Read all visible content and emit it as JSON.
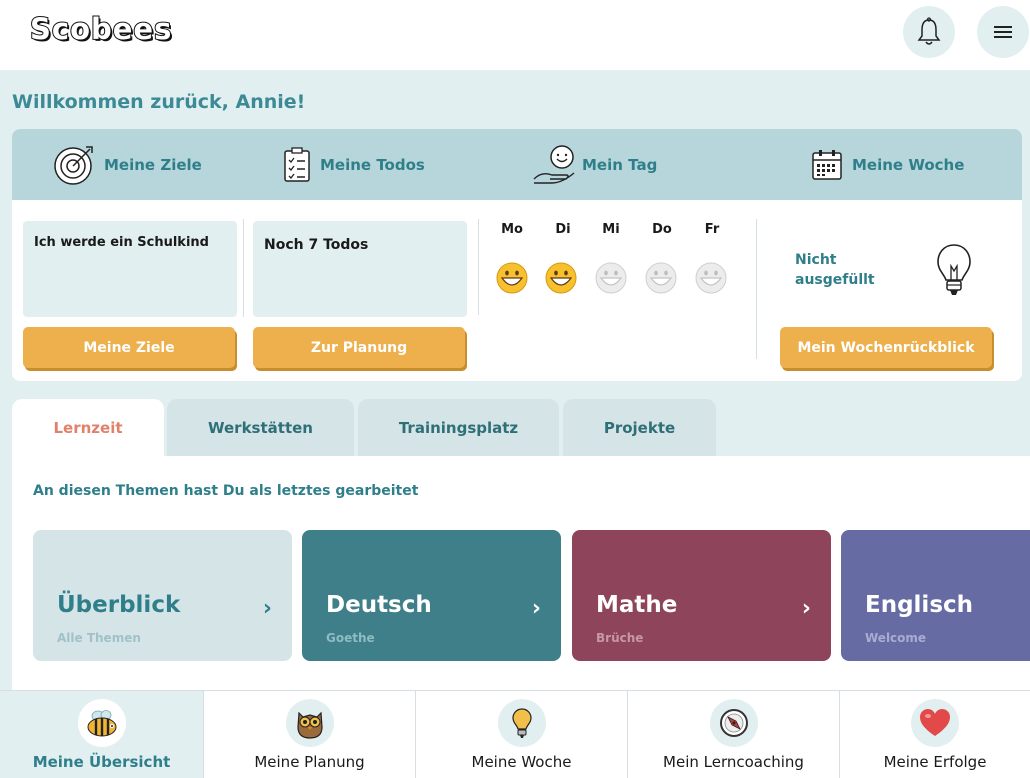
{
  "header": {
    "logo_text": "Scobees"
  },
  "welcome": "Willkommen zurück, Annie!",
  "overview_nav": [
    {
      "label": "Meine Ziele",
      "icon": "target-icon"
    },
    {
      "label": "Meine Todos",
      "icon": "checklist-icon"
    },
    {
      "label": "Mein Tag",
      "icon": "smiley-hand-icon"
    },
    {
      "label": "Meine Woche",
      "icon": "calendar-icon"
    }
  ],
  "goals": {
    "text": "Ich werde ein Schulkind",
    "button": "Meine Ziele"
  },
  "todos": {
    "text": "Noch 7 Todos",
    "button": "Zur Planung"
  },
  "days": [
    {
      "label": "Mo",
      "filled": true
    },
    {
      "label": "Di",
      "filled": true
    },
    {
      "label": "Mi",
      "filled": false
    },
    {
      "label": "Do",
      "filled": false
    },
    {
      "label": "Fr",
      "filled": false
    }
  ],
  "week": {
    "status": "Nicht ausgefüllt",
    "button": "Mein Wochenrückblick"
  },
  "tabs": [
    "Lernzeit",
    "Werkstätten",
    "Trainingsplatz",
    "Projekte"
  ],
  "active_tab": "Lernzeit",
  "recent_heading": "An diesen Themen hast Du als letztes gearbeitet",
  "cards": [
    {
      "title": "Überblick",
      "subtitle": "Alle Themen",
      "color": "#d5e4e6"
    },
    {
      "title": "Deutsch",
      "subtitle": "Goethe",
      "color": "#3f7f89"
    },
    {
      "title": "Mathe",
      "subtitle": "Brüche",
      "color": "#8e455b"
    },
    {
      "title": "Englisch",
      "subtitle": "Welcome",
      "color": "#666ca3"
    }
  ],
  "bottom_nav": [
    {
      "label": "Meine Übersicht",
      "icon": "bee-icon",
      "active": true
    },
    {
      "label": "Meine Planung",
      "icon": "owl-icon",
      "active": false
    },
    {
      "label": "Meine Woche",
      "icon": "lightbulb-icon",
      "active": false
    },
    {
      "label": "Mein Lerncoaching",
      "icon": "compass-icon",
      "active": false
    },
    {
      "label": "Meine Erfolge",
      "icon": "heart-icon",
      "active": false
    }
  ],
  "colors": {
    "accent": "#3b8a95",
    "button": "#edb04c",
    "background": "#e2eff1",
    "active_tab": "#e0826a"
  }
}
